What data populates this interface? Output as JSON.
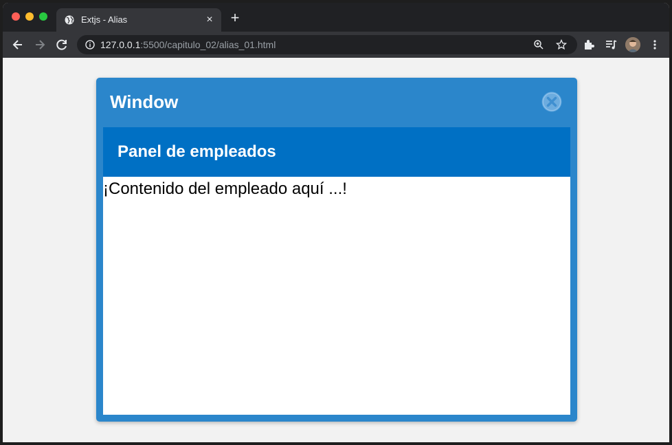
{
  "browser": {
    "tab_title": "Extjs - Alias",
    "tab_close_glyph": "×",
    "new_tab_glyph": "+",
    "url_host": "127.0.0.1",
    "url_rest": ":5500/capitulo_02/alias_01.html",
    "icons": [
      "globe-icon",
      "back-icon",
      "forward-icon",
      "reload-icon",
      "info-icon",
      "zoom-icon",
      "star-icon",
      "extensions-icon",
      "media-icon",
      "menu-icon"
    ]
  },
  "window": {
    "title": "Window",
    "close_icon": "close-icon",
    "accent": "#2b86cb"
  },
  "panel": {
    "title": "Panel de empleados",
    "content": "¡Contenido del empleado aquí ...!",
    "header_color": "#0070c4"
  }
}
